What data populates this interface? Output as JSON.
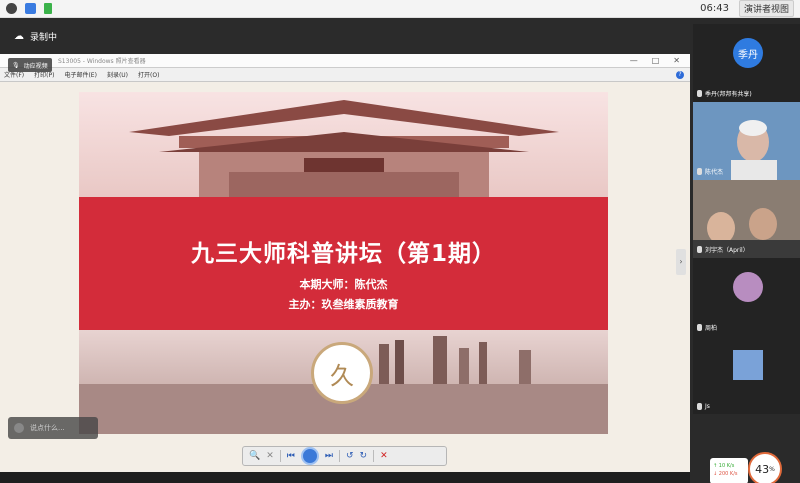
{
  "system": {
    "time": "06:43",
    "window_chip": "演讲者视图"
  },
  "recording": {
    "label": "录制中"
  },
  "window": {
    "title": "S13005 - Windows 照片查看器",
    "menu": [
      "文件(F)",
      "打印(P)",
      "电子邮件(E)",
      "刻录(U)",
      "打开(O)"
    ],
    "pill_label": "动应视频"
  },
  "slide": {
    "title": "九三大师科普讲坛（第1期）",
    "line1": "本期大师：陈代杰",
    "line2": "主办：玖叁维素质教育",
    "logo_text": "久"
  },
  "prompt": {
    "text": "说点什么..."
  },
  "participants": [
    {
      "name": "季丹",
      "tag": "季丹(邦邦有共享)"
    },
    {
      "name": "陈代杰"
    },
    {
      "name": "刘宇杰（April）"
    },
    {
      "name": "周柏"
    },
    {
      "name": "Js"
    }
  ],
  "network": {
    "up": "↑ 10 K/s",
    "down": "↓ 200 K/s",
    "percent": "43",
    "unit": "%"
  }
}
